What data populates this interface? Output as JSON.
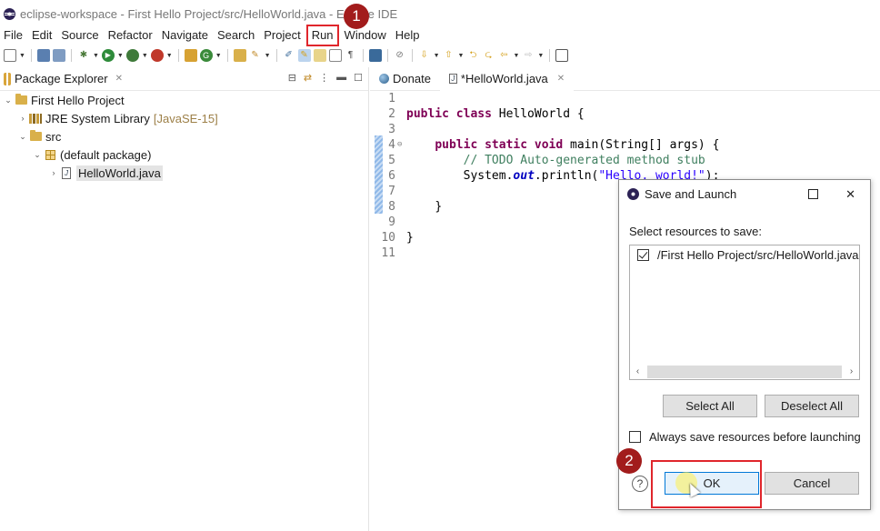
{
  "window": {
    "title": "eclipse-workspace - First Hello Project/src/HelloWorld.java - Eclipse IDE"
  },
  "menu": {
    "items": [
      "File",
      "Edit",
      "Source",
      "Refactor",
      "Navigate",
      "Search",
      "Project",
      "Run",
      "Window",
      "Help"
    ]
  },
  "steps": {
    "one": "1",
    "two": "2"
  },
  "toolbar": {
    "icons": [
      "new-icon",
      "save-icon",
      "save-all-icon",
      "debug-icon",
      "run-icon",
      "coverage-icon",
      "external-tools-icon",
      "new-java-project-icon",
      "new-class-icon",
      "open-type-icon",
      "search-icon",
      "toggle-mark-occurrences-icon",
      "show-whitespace-icon",
      "next-annotation-icon",
      "previous-annotation-icon",
      "back-icon",
      "forward-icon",
      "pin-editor-icon"
    ]
  },
  "package_explorer": {
    "title": "Package Explorer",
    "tree": {
      "project": "First Hello Project",
      "jre": "JRE System Library",
      "jre_version": "[JavaSE-15]",
      "src": "src",
      "package": "(default package)",
      "file": "HelloWorld.java"
    }
  },
  "editor": {
    "tabs": [
      {
        "label": "Donate"
      },
      {
        "label": "*HelloWorld.java"
      }
    ],
    "line_numbers": [
      "1",
      "2",
      "3",
      "4",
      "5",
      "6",
      "7",
      "8",
      "9",
      "10",
      "11"
    ],
    "code": {
      "l2_kw": "public class ",
      "l2_rest": "HelloWorld {",
      "l4_kw": "public static void ",
      "l4_rest": "main(String[] args) {",
      "l5": "// TODO Auto-generated method stub",
      "l6_a": "System.",
      "l6_out": "out",
      "l6_b": ".println(",
      "l6_str": "\"Hello, world!\"",
      "l6_c": ");",
      "l8": "}",
      "l10": "}"
    }
  },
  "dialog": {
    "title": "Save and Launch",
    "prompt": "Select resources to save:",
    "resources": [
      {
        "path": "/First Hello Project/src/HelloWorld.java",
        "checked": true
      }
    ],
    "select_all": "Select All",
    "deselect_all": "Deselect All",
    "always_save": "Always save resources before launching",
    "always_save_checked": false,
    "help": "?",
    "ok": "OK",
    "cancel": "Cancel"
  },
  "colors": {
    "highlight": "#e0262c",
    "step_marker": "#a21c1c",
    "keyword": "#7f0055",
    "comment": "#3f7f5f",
    "string": "#2a00ff"
  }
}
